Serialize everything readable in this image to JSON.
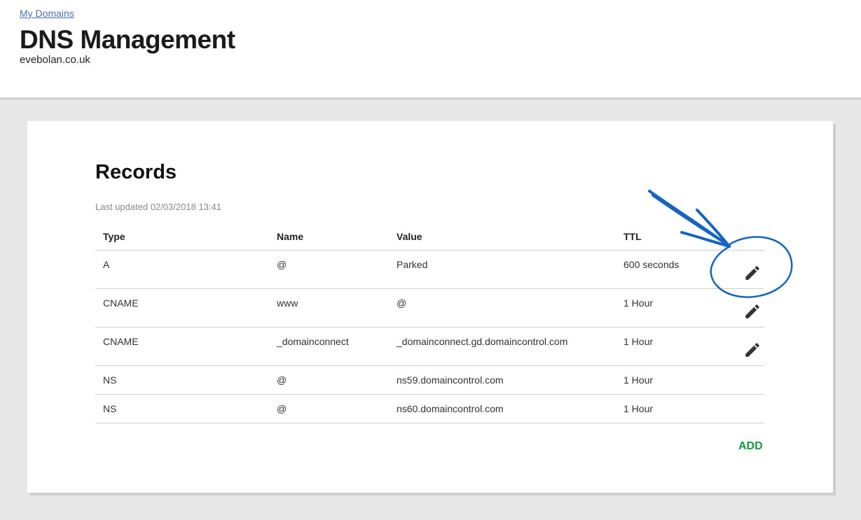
{
  "header": {
    "breadcrumb": "My Domains",
    "title": "DNS Management",
    "domain": "evebolan.co.uk"
  },
  "records": {
    "title": "Records",
    "last_updated": "Last updated 02/03/2018 13:41",
    "columns": [
      "Type",
      "Name",
      "Value",
      "TTL"
    ],
    "rows": [
      {
        "type": "A",
        "name": "@",
        "value": "Parked",
        "ttl": "600 seconds",
        "editable": true
      },
      {
        "type": "CNAME",
        "name": "www",
        "value": "@",
        "ttl": "1 Hour",
        "editable": true
      },
      {
        "type": "CNAME",
        "name": "_domainconnect",
        "value": "_domainconnect.gd.domaincontrol.com",
        "ttl": "1 Hour",
        "editable": true
      },
      {
        "type": "NS",
        "name": "@",
        "value": "ns59.domaincontrol.com",
        "ttl": "1 Hour",
        "editable": false
      },
      {
        "type": "NS",
        "name": "@",
        "value": "ns60.domaincontrol.com",
        "ttl": "1 Hour",
        "editable": false
      }
    ],
    "add_label": "ADD"
  },
  "colors": {
    "link": "#4a6fb3",
    "add": "#109a3c",
    "annotation": "#1565c0",
    "background": "#e8e8e8"
  },
  "icons": {
    "edit": "pencil-icon",
    "annotation": "arrow-circle-annotation"
  }
}
